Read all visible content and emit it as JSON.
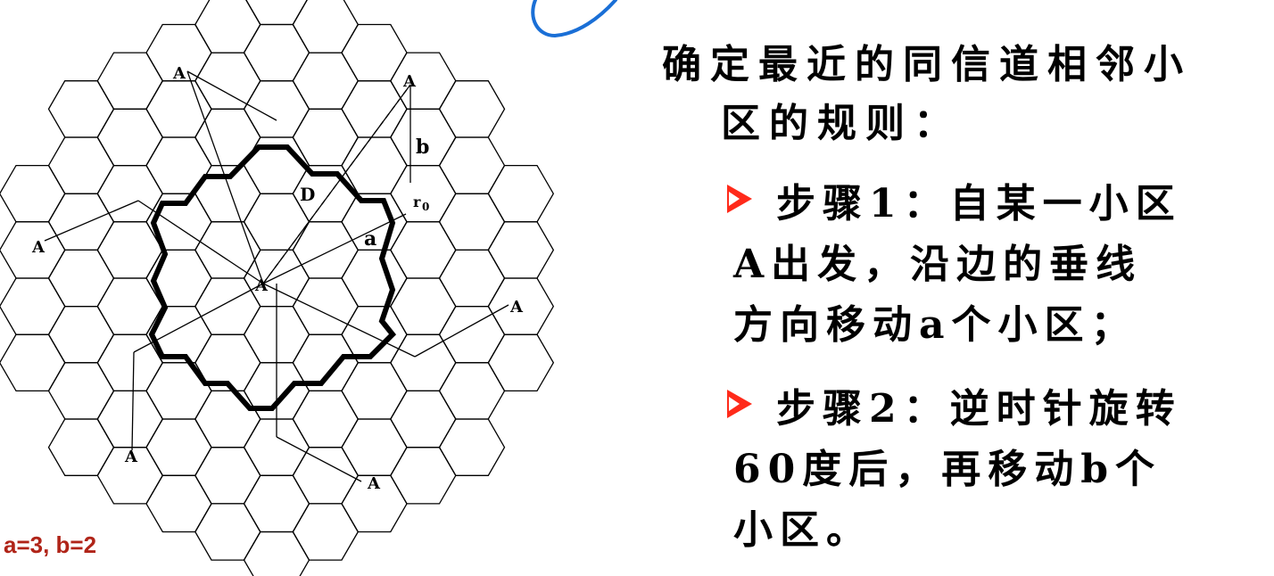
{
  "diagram": {
    "labels": {
      "cell": "A",
      "b_label": "b",
      "d_label": "D",
      "r_label": "r",
      "r_sub": "0",
      "a_label": "a"
    },
    "caption": "a=3, b=2"
  },
  "panel": {
    "heading_line1": "确定最近的同信道相邻小",
    "heading_line2": "区的规则：",
    "steps": [
      {
        "line1": "步骤1：自某一小区",
        "line2": "A出发，沿边的垂线",
        "line3": "方向移动a个小区；"
      },
      {
        "line1": "步骤2：逆时针旋转",
        "line2": "60度后，再移动b个",
        "line3": "小区。"
      }
    ]
  },
  "colors": {
    "bullet": "#ff2a1a",
    "caption": "#b02418",
    "stroke_blue": "#1a6fd6"
  }
}
